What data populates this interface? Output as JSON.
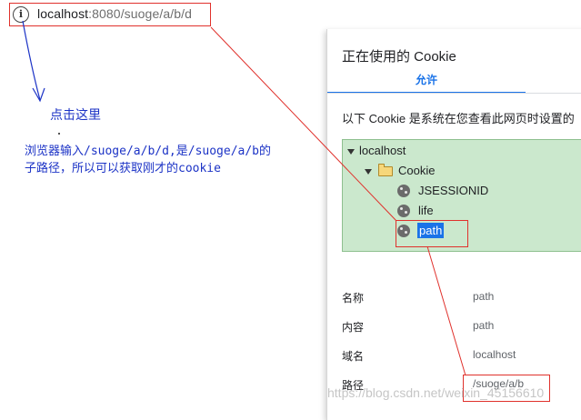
{
  "browser": {
    "url_host": "localhost",
    "url_rest": ":8080/suoge/a/b/d",
    "info_icon": "info-circle-icon",
    "info_glyph": "i"
  },
  "annotations": {
    "click_here": "点击这里",
    "description_line1": "浏览器输入/suoge/a/b/d,是/suoge/a/b的",
    "description_line2": "子路径，所以可以获取刚才的cookie",
    "color": "#1c33c6"
  },
  "cookie_dialog": {
    "title": "正在使用的 Cookie",
    "tabs": [
      {
        "label": "允许",
        "active": true
      }
    ],
    "description": "以下 Cookie 是系统在您查看此网页时设置的",
    "tree": {
      "site": "localhost",
      "folder": "Cookie",
      "cookies": [
        {
          "name": "JSESSIONID",
          "selected": false
        },
        {
          "name": "life",
          "selected": false
        },
        {
          "name": "path",
          "selected": true
        }
      ]
    },
    "properties": [
      {
        "label": "名称",
        "value": "path"
      },
      {
        "label": "内容",
        "value": "path"
      },
      {
        "label": "域名",
        "value": "localhost"
      },
      {
        "label": "路径",
        "value": "/suoge/a/b"
      }
    ],
    "selection_color": "#1a73e8",
    "tree_bg": "#cbe8cd"
  },
  "watermark": "https://blog.csdn.net/weixin_45156610",
  "highlight_color": "#e0312c"
}
